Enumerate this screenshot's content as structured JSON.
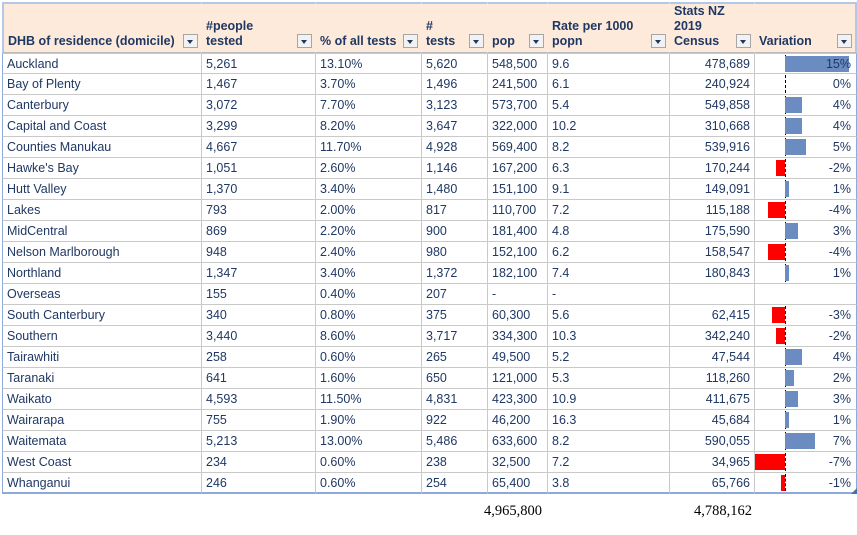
{
  "table": {
    "columns": [
      {
        "key": "dhb",
        "label": "DHB of residence (domicile)",
        "align": "left"
      },
      {
        "key": "tested",
        "label": "#people tested",
        "align": "left"
      },
      {
        "key": "pct",
        "label": "% of all tests",
        "align": "left"
      },
      {
        "key": "tests",
        "label": "# tests",
        "align": "left"
      },
      {
        "key": "pop",
        "label": "pop",
        "align": "left"
      },
      {
        "key": "rate",
        "label": "Rate per 1000 popn",
        "align": "left"
      },
      {
        "key": "census",
        "label": "Stats NZ 2019 Census",
        "align": "right"
      },
      {
        "key": "variation",
        "label": "Variation",
        "align": "right"
      }
    ],
    "filter_icon": "filter-dropdown-icon",
    "rows": [
      {
        "dhb": "Auckland",
        "tested": "5,261",
        "pct": "13.10%",
        "tests": "5,620",
        "pop": "548,500",
        "rate": "9.6",
        "census": "478,689",
        "variation": "15%",
        "var_value": 15
      },
      {
        "dhb": "Bay of Plenty",
        "tested": "1,467",
        "pct": "3.70%",
        "tests": "1,496",
        "pop": "241,500",
        "rate": "6.1",
        "census": "240,924",
        "variation": "0%",
        "var_value": 0
      },
      {
        "dhb": "Canterbury",
        "tested": "3,072",
        "pct": "7.70%",
        "tests": "3,123",
        "pop": "573,700",
        "rate": "5.4",
        "census": "549,858",
        "variation": "4%",
        "var_value": 4
      },
      {
        "dhb": "Capital and Coast",
        "tested": "3,299",
        "pct": "8.20%",
        "tests": "3,647",
        "pop": "322,000",
        "rate": "10.2",
        "census": "310,668",
        "variation": "4%",
        "var_value": 4
      },
      {
        "dhb": "Counties Manukau",
        "tested": "4,667",
        "pct": "11.70%",
        "tests": "4,928",
        "pop": "569,400",
        "rate": "8.2",
        "census": "539,916",
        "variation": "5%",
        "var_value": 5
      },
      {
        "dhb": "Hawke's Bay",
        "tested": "1,051",
        "pct": "2.60%",
        "tests": "1,146",
        "pop": "167,200",
        "rate": "6.3",
        "census": "170,244",
        "variation": "-2%",
        "var_value": -2
      },
      {
        "dhb": "Hutt Valley",
        "tested": "1,370",
        "pct": "3.40%",
        "tests": "1,480",
        "pop": "151,100",
        "rate": "9.1",
        "census": "149,091",
        "variation": "1%",
        "var_value": 1
      },
      {
        "dhb": "Lakes",
        "tested": "793",
        "pct": "2.00%",
        "tests": "817",
        "pop": "110,700",
        "rate": "7.2",
        "census": "115,188",
        "variation": "-4%",
        "var_value": -4
      },
      {
        "dhb": "MidCentral",
        "tested": "869",
        "pct": "2.20%",
        "tests": "900",
        "pop": "181,400",
        "rate": "4.8",
        "census": "175,590",
        "variation": "3%",
        "var_value": 3
      },
      {
        "dhb": "Nelson Marlborough",
        "tested": "948",
        "pct": "2.40%",
        "tests": "980",
        "pop": "152,100",
        "rate": "6.2",
        "census": "158,547",
        "variation": "-4%",
        "var_value": -4
      },
      {
        "dhb": "Northland",
        "tested": "1,347",
        "pct": "3.40%",
        "tests": "1,372",
        "pop": "182,100",
        "rate": "7.4",
        "census": "180,843",
        "variation": "1%",
        "var_value": 1
      },
      {
        "dhb": "Overseas",
        "tested": "155",
        "pct": "0.40%",
        "tests": "207",
        "pop": "-",
        "rate": "-",
        "census": "",
        "variation": "",
        "var_value": null
      },
      {
        "dhb": "South Canterbury",
        "tested": "340",
        "pct": "0.80%",
        "tests": "375",
        "pop": "60,300",
        "rate": "5.6",
        "census": "62,415",
        "variation": "-3%",
        "var_value": -3
      },
      {
        "dhb": "Southern",
        "tested": "3,440",
        "pct": "8.60%",
        "tests": "3,717",
        "pop": "334,300",
        "rate": "10.3",
        "census": "342,240",
        "variation": "-2%",
        "var_value": -2
      },
      {
        "dhb": "Tairawhiti",
        "tested": "258",
        "pct": "0.60%",
        "tests": "265",
        "pop": "49,500",
        "rate": "5.2",
        "census": "47,544",
        "variation": "4%",
        "var_value": 4
      },
      {
        "dhb": "Taranaki",
        "tested": "641",
        "pct": "1.60%",
        "tests": "650",
        "pop": "121,000",
        "rate": "5.3",
        "census": "118,260",
        "variation": "2%",
        "var_value": 2
      },
      {
        "dhb": "Waikato",
        "tested": "4,593",
        "pct": "11.50%",
        "tests": "4,831",
        "pop": "423,300",
        "rate": "10.9",
        "census": "411,675",
        "variation": "3%",
        "var_value": 3
      },
      {
        "dhb": "Wairarapa",
        "tested": "755",
        "pct": "1.90%",
        "tests": "922",
        "pop": "46,200",
        "rate": "16.3",
        "census": "45,684",
        "variation": "1%",
        "var_value": 1
      },
      {
        "dhb": "Waitemata",
        "tested": "5,213",
        "pct": "13.00%",
        "tests": "5,486",
        "pop": "633,600",
        "rate": "8.2",
        "census": "590,055",
        "variation": "7%",
        "var_value": 7
      },
      {
        "dhb": "West Coast",
        "tested": "234",
        "pct": "0.60%",
        "tests": "238",
        "pop": "32,500",
        "rate": "7.2",
        "census": "34,965",
        "variation": "-7%",
        "var_value": -7
      },
      {
        "dhb": "Whanganui",
        "tested": "246",
        "pct": "0.60%",
        "tests": "254",
        "pop": "65,400",
        "rate": "3.8",
        "census": "65,766",
        "variation": "-1%",
        "var_value": -1
      }
    ]
  },
  "totals": {
    "pop": "4,965,800",
    "census": "4,788,162"
  },
  "colors": {
    "header_background": "#FDEADA",
    "header_text": "#1F3864",
    "positive_bar": "#6A8CC0",
    "negative_bar": "#FF0000",
    "grid_line": "#C9C9C9",
    "table_border": "#8EAADB"
  }
}
